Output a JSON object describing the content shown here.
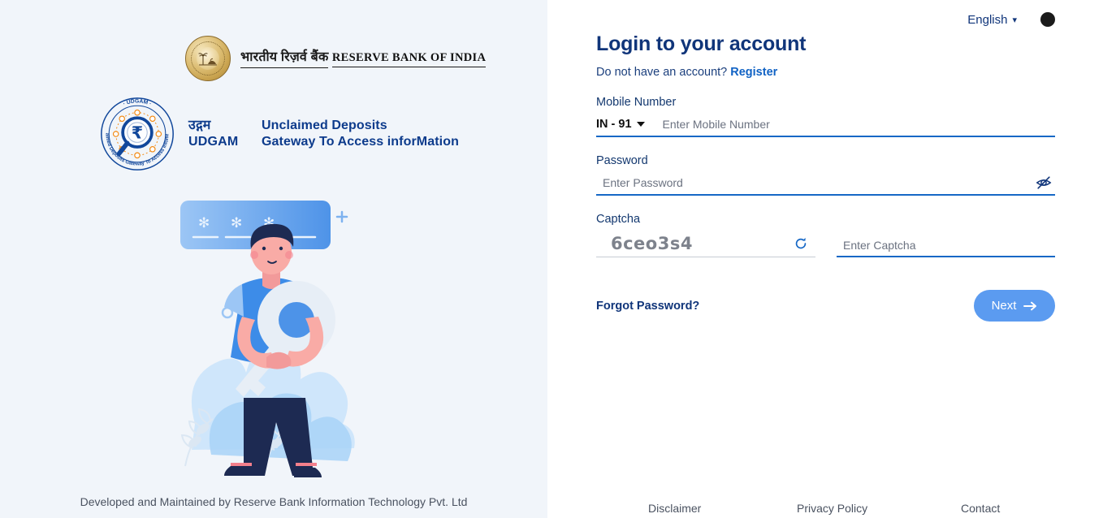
{
  "branding": {
    "rbi": {
      "hindi_name": "भारतीय रिज़र्व बैंक",
      "english_name": "RESERVE BANK OF INDIA",
      "seal_icon": "rbi-seal-icon"
    },
    "udgam": {
      "emblem_icon": "udgam-emblem-icon",
      "emblem_ring_text": "Unclaimed Deposits Gateway To Access inforMation · UDGAM ·",
      "hindi_word": "उद्गम",
      "word": "UDGAM",
      "tagline_line1": "Unclaimed Deposits",
      "tagline_line2": "Gateway To Access inforMation"
    }
  },
  "illustration": {
    "name": "login-security-illustration",
    "password_card_masks": "✻ ✻ ✻"
  },
  "topbar": {
    "language": "English",
    "language_chevron_icon": "chevron-down-icon",
    "theme_toggle_icon": "dark-mode-moon-icon"
  },
  "login": {
    "title": "Login to your account",
    "no_account_text": "Do not have an account?",
    "register_label": "Register",
    "mobile": {
      "label": "Mobile Number",
      "country_code": "IN - 91",
      "country_chevron_icon": "caret-down-icon",
      "placeholder": "Enter Mobile Number",
      "value": ""
    },
    "password": {
      "label": "Password",
      "placeholder": "Enter Password",
      "value": "",
      "visibility_icon": "eye-off-icon"
    },
    "captcha": {
      "label": "Captcha",
      "code": "6ceo3s4",
      "refresh_icon": "refresh-icon",
      "placeholder": "Enter Captcha",
      "value": ""
    },
    "forgot_password_label": "Forgot Password?",
    "next_label": "Next",
    "next_arrow_icon": "arrow-right-icon"
  },
  "footer": {
    "left_credit": "Developed and Maintained by Reserve Bank Information Technology Pvt. Ltd",
    "links": [
      "Disclaimer",
      "Privacy Policy",
      "Contact"
    ]
  },
  "colors": {
    "left_panel_bg": "#f1f5fa",
    "primary_navy": "#10357a",
    "accent_blue": "#1668c6",
    "button_blue": "#5b9bf0",
    "link_blue": "#1062c4"
  }
}
